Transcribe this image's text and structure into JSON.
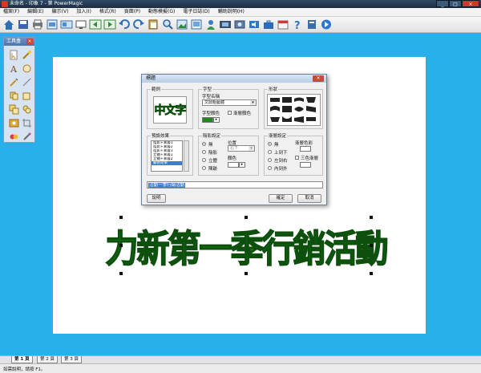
{
  "window": {
    "title": "未命名 - 印象 7 - 第 PowerMagic",
    "min": "_",
    "max": "□",
    "close": "×"
  },
  "menu": [
    "檔案(F)",
    "編輯(E)",
    "顯示(V)",
    "加入(I)",
    "格式(R)",
    "頁面(P)",
    "動態模擬(G)",
    "電子日誌(D)",
    "輔助說明(H)"
  ],
  "toolbox": {
    "title": "工具盒",
    "close": "×"
  },
  "dialog": {
    "title": "標題",
    "close": "×",
    "sample_group": "範例",
    "sample_text": "中文字",
    "font_group": "字型",
    "font_name_label": "字型名稱",
    "font_name_value": "文鼎粗藝體",
    "font_color_label": "字型顏色",
    "gradient_label": "漸層顏色",
    "shape_group": "形狀",
    "preset_group": "預設效果",
    "preset_items": [
      "陰影+漸層1",
      "陰影+漸層2",
      "陰影+漸層3",
      "立體+漸層1",
      "立體+漸層2",
      "藝術效果"
    ],
    "shadow_group": "陰影設定",
    "shadow_options": [
      "無",
      "陰影",
      "立體",
      "陳跡"
    ],
    "position_label": "位置",
    "position_value": "右下",
    "shadow_color_label": "顏色",
    "gradient_group": "漸層設定",
    "gradient_options": [
      "無",
      "上到下",
      "左到右",
      "內到外"
    ],
    "gradient_color_label": "漸層色彩",
    "three_color_label": "三色漸層",
    "text_input": "活動一季行銷活動",
    "help_button": "說明",
    "ok_button": "確定",
    "cancel_button": "取消"
  },
  "canvas": {
    "headline": "力新第一季行銷活動"
  },
  "pages": [
    "第 1 頁",
    "第 2 頁",
    "第 3 頁"
  ],
  "status": "如需說明，請按 F1。",
  "colors": {
    "workspace": "#27b0e9",
    "headline": "#1a8a1a",
    "title_bar": "#2f4a68"
  }
}
